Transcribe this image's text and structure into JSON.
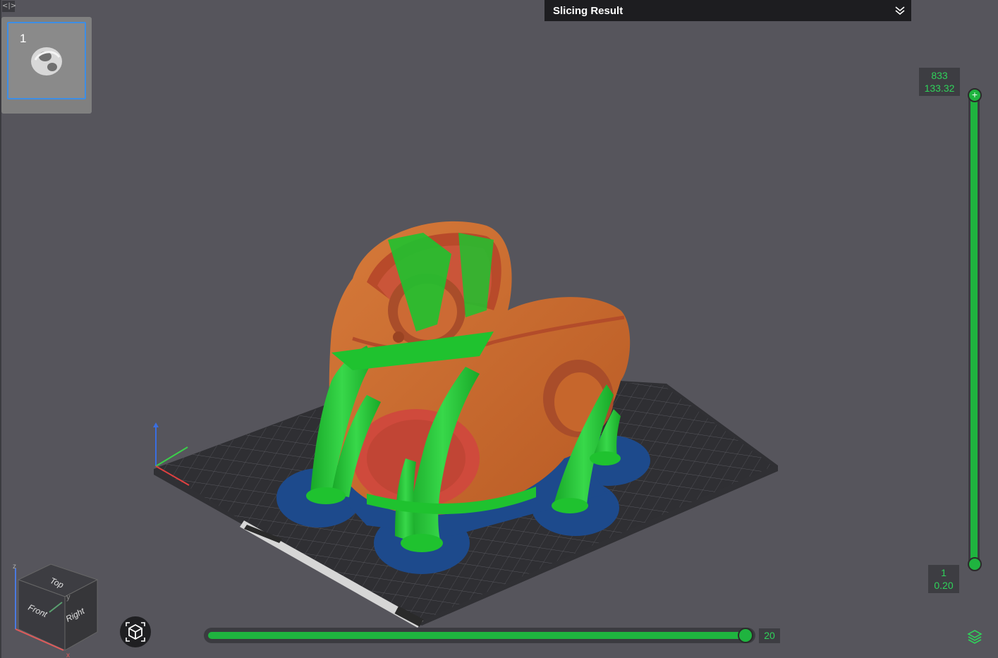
{
  "plate_panel": {
    "plate_number": "1"
  },
  "slicing_result": {
    "title": "Slicing Result"
  },
  "layer_slider": {
    "top": {
      "layer": "833",
      "height": "133.32"
    },
    "bottom": {
      "layer": "1",
      "height": "0.20"
    }
  },
  "move_slider": {
    "value": "20",
    "progress": 0.98
  },
  "nav_cube": {
    "top": "Top",
    "front": "Front",
    "right": "Right",
    "axis_z": "z",
    "axis_y": "y",
    "axis_x": "x"
  },
  "colors": {
    "background": "#56555c",
    "model": "#c6662c",
    "support": "#1fc22f",
    "raft": "#1d4a8c",
    "accent": "#1fb43f"
  },
  "icons": [
    "collapse-icon",
    "expand-chevrons-icon",
    "camera-view-icon",
    "layers-icon"
  ]
}
